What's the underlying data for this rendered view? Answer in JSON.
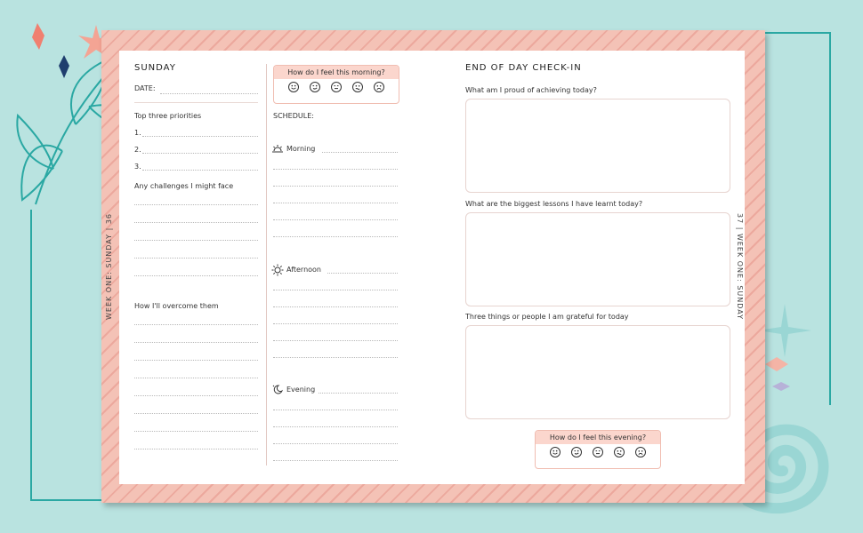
{
  "colors": {
    "background": "#b9e3e0",
    "border": "#f4c2b6",
    "accent_teal": "#2aa8a3",
    "accent_navy": "#1f3e6e",
    "accent_coral": "#f08070"
  },
  "side_left_label": "WEEK ONE: SUNDAY | 36",
  "side_right_label": "37 | WEEK ONE: SUNDAY",
  "left": {
    "day": "SUNDAY",
    "date_label": "DATE:",
    "priorities_title": "Top three priorities",
    "priorities": [
      "1.",
      "2.",
      "3."
    ],
    "challenges_title": "Any challenges I might face",
    "overcome_title": "How I'll overcome them"
  },
  "middle": {
    "morning_mood_prompt": "How do I feel this morning?",
    "schedule_label": "SCHEDULE:",
    "slots": [
      "Morning",
      "Afternoon",
      "Evening"
    ]
  },
  "right": {
    "title": "END OF DAY CHECK-IN",
    "q1": "What am I proud of achieving today?",
    "q2": "What are the biggest lessons I have learnt today?",
    "q3": "Three things or people I am grateful for today",
    "evening_mood_prompt": "How do I feel this evening?"
  },
  "mood_faces": [
    "happy-face-icon",
    "wink-face-icon",
    "neutral-face-icon",
    "worried-face-icon",
    "sad-face-icon"
  ]
}
